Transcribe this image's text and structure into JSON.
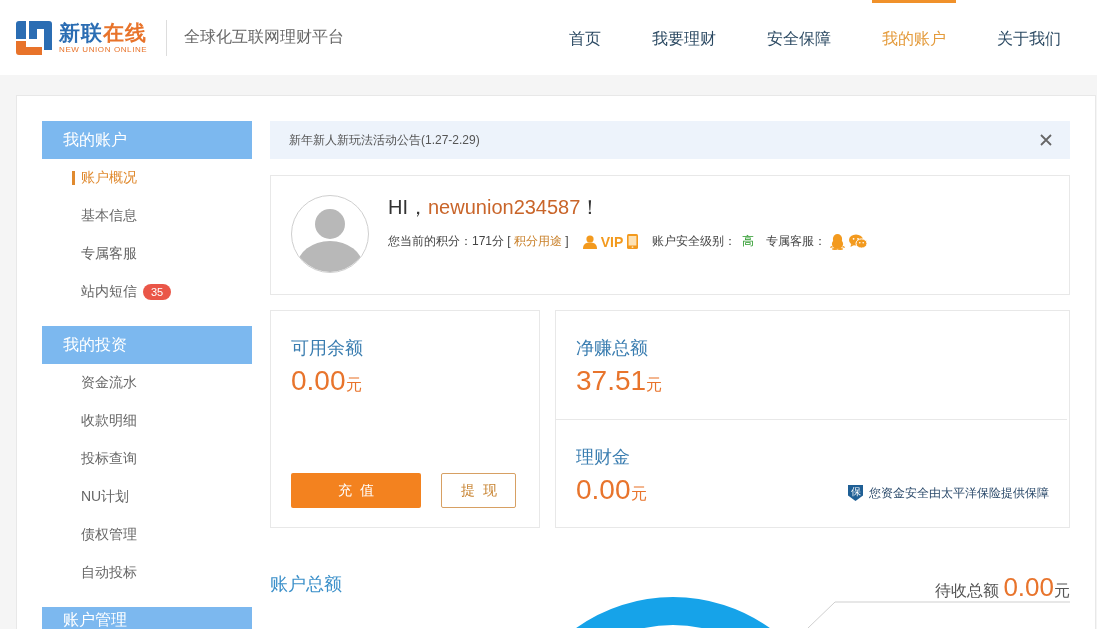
{
  "header": {
    "logo": {
      "name_first": "新联",
      "name_second": "在线",
      "subtitle": "NEW UNION ONLINE"
    },
    "tagline": "全球化互联网理财平台",
    "nav": [
      {
        "label": "首页",
        "selected": false
      },
      {
        "label": "我要理财",
        "selected": false
      },
      {
        "label": "安全保障",
        "selected": false
      },
      {
        "label": "我的账户",
        "selected": true
      },
      {
        "label": "关于我们",
        "selected": false
      }
    ]
  },
  "sidebar": {
    "sections": [
      {
        "title": "我的账户",
        "items": [
          {
            "label": "账户概况",
            "selected": true
          },
          {
            "label": "基本信息",
            "selected": false
          },
          {
            "label": "专属客服",
            "selected": false
          },
          {
            "label": "站内短信",
            "selected": false,
            "badge": "35"
          }
        ]
      },
      {
        "title": "我的投资",
        "items": [
          {
            "label": "资金流水",
            "selected": false
          },
          {
            "label": "收款明细",
            "selected": false
          },
          {
            "label": "投标查询",
            "selected": false
          },
          {
            "label": "NU计划",
            "selected": false
          },
          {
            "label": "债权管理",
            "selected": false
          },
          {
            "label": "自动投标",
            "selected": false
          }
        ]
      },
      {
        "title": "账户管理"
      }
    ]
  },
  "notice": {
    "text": "新年新人新玩法活动公告(1.27-2.29)"
  },
  "profile": {
    "greeting": "HI，",
    "username": "newunion234587",
    "greeting_end": "！",
    "points": "您当前的积分：171分",
    "bracket_open": "[",
    "points_link": "积分用途",
    "bracket_close": "]",
    "vip": "VIP",
    "security_label": "账户安全级别：",
    "security_level": "高",
    "service_label": "专属客服："
  },
  "balance_card": {
    "label": "可用余额",
    "amount": "0.00",
    "unit": "元",
    "buttons": [
      {
        "label": "充值",
        "kind": "primary"
      },
      {
        "label": "提现",
        "kind": "outline"
      }
    ]
  },
  "earnings_card": {
    "stats": [
      {
        "label": "净赚总额",
        "amount": "37.51",
        "unit": "元"
      },
      {
        "label": "理财金",
        "amount": "0.00",
        "unit": "元"
      }
    ],
    "insurance_badge": "保",
    "insurance_note": "您资金安全由太平洋保险提供保障"
  },
  "summary": {
    "title": "账户总额",
    "pending_label": "待收总额",
    "pending_amount": "0.00",
    "pending_unit": "元"
  }
}
